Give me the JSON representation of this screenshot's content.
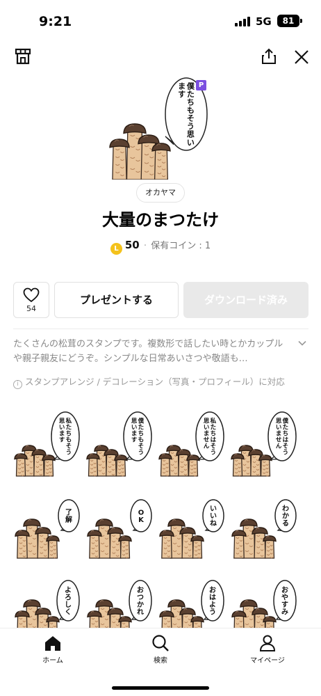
{
  "status_bar": {
    "time": "9:21",
    "network": "5G",
    "battery": "81"
  },
  "product": {
    "author": "オカヤマ",
    "title": "大量のまつたけ",
    "hero_badge": "P",
    "coin_symbol": "L",
    "price": "50",
    "owned_coins": "保有コイン : 1"
  },
  "actions": {
    "like_count": "54",
    "present_label": "プレゼントする",
    "download_label": "ダウンロード済み"
  },
  "description": "たくさんの松茸のスタンプです。複数形で話したい時とかカップルや親子親友にどうぞ。シンプルな日常あいさつや敬語も…",
  "arrange_note": "スタンプアレンジ / デコレーション（写真・プロフィール）に対応",
  "info_glyph": "i",
  "stickers": [
    "私たちもそう思います",
    "僕たちもそう思います",
    "私たちはそう思いません",
    "僕たちはそう思いません",
    "了解",
    "OK",
    "いいね",
    "わかる",
    "よろしく",
    "おつかれ",
    "おはよう",
    "おやすみ"
  ],
  "hero_bubble": "僕たちもそう思います",
  "tabs": [
    {
      "label": "ホーム",
      "icon": "home-icon"
    },
    {
      "label": "検索",
      "icon": "search-icon"
    },
    {
      "label": "マイページ",
      "icon": "person-icon"
    }
  ],
  "colors": {
    "coin": "#f4c21c",
    "premium_badge": "#7b4fe0",
    "disabled_button": "#e9e9e9"
  }
}
